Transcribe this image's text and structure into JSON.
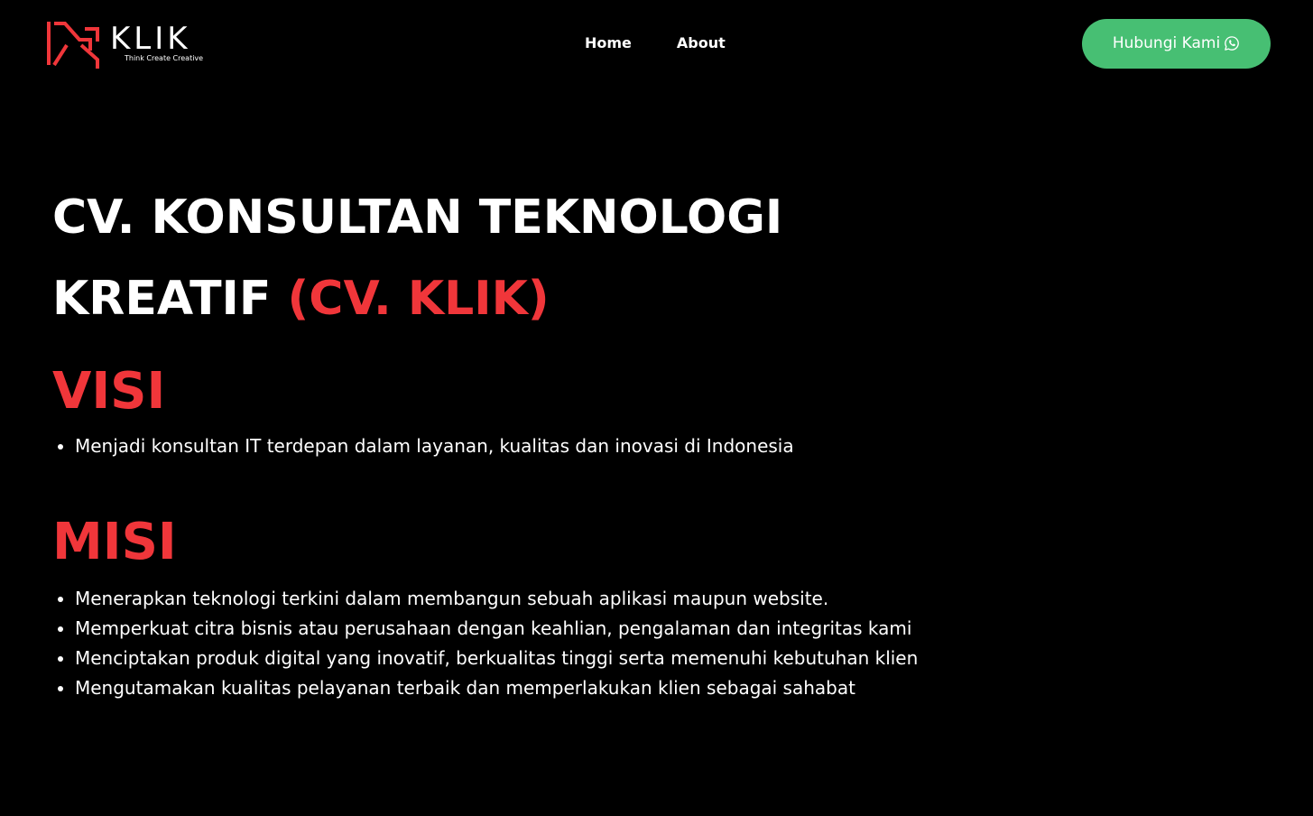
{
  "brand": {
    "name": "KLIK",
    "tagline": "Think Create Creative",
    "accent_color": "#f0363a"
  },
  "nav": {
    "items": [
      {
        "label": "Home"
      },
      {
        "label": "About"
      }
    ]
  },
  "contact_button": {
    "label": "Hubungi Kami",
    "icon": "whatsapp-icon",
    "color": "#47bf73"
  },
  "hero": {
    "title_line1": "CV. KONSULTAN TEKNOLOGI",
    "title_line2_white": "KREATIF ",
    "title_line2_accent": "(CV. KLIK)"
  },
  "visi": {
    "heading": "VISI",
    "items": [
      "Menjadi konsultan IT terdepan dalam layanan, kualitas dan inovasi di Indonesia"
    ]
  },
  "misi": {
    "heading": "MISI",
    "items": [
      "Menerapkan teknologi terkini dalam membangun sebuah aplikasi maupun website.",
      "Memperkuat citra bisnis atau perusahaan dengan keahlian, pengalaman dan integritas kami",
      "Menciptakan produk digital yang inovatif, berkualitas tinggi serta memenuhi kebutuhan klien",
      "Mengutamakan kualitas pelayanan terbaik dan memperlakukan klien sebagai sahabat"
    ]
  }
}
